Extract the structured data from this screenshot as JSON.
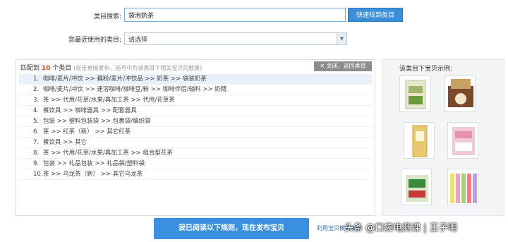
{
  "search": {
    "label": "类目搜索:",
    "value": "袋泡奶茶",
    "button_label": "快速找到类目"
  },
  "recent": {
    "label": "您最近使用的类目:",
    "selected": "请选择"
  },
  "matches": {
    "prefix": "匹配到",
    "count": "10",
    "suffix": "个类目",
    "hint": "(双击直接发布，括号中为该类目下相关宝贝的数量)",
    "close_label": "关闭，返回类目",
    "items": [
      {
        "num": "1.",
        "text": "咖啡/麦片/冲饮 >> 藕粉/麦片/冲饮品 >> 奶茶 >> 袋装奶茶"
      },
      {
        "num": "2.",
        "text": "咖啡/麦片/冲饮 >> 速溶咖啡/咖啡豆/粉 >> 咖啡伴侣/辅料 >> 奶精"
      },
      {
        "num": "3.",
        "text": "茶 >> 代用/花草/水果/再加工茶 >> 代用/花草茶"
      },
      {
        "num": "4.",
        "text": "餐饮具 >> 咖啡器具 >> 配套器具"
      },
      {
        "num": "5.",
        "text": "包装 >> 塑料包装袋 >> 包裹袋/编织袋"
      },
      {
        "num": "6.",
        "text": "茶 >> 红茶（新） >> 其它红茶"
      },
      {
        "num": "7.",
        "text": "餐饮具 >> 其它"
      },
      {
        "num": "8.",
        "text": "茶 >> 代用/花草/水果/再加工茶 >> 组合型花茶"
      },
      {
        "num": "9.",
        "text": "包装 >> 礼品包装 >> 礼品袋/塑料袋"
      },
      {
        "num": "10.",
        "text": "茶 >> 乌龙茶（新） >> 其它乌龙茶"
      }
    ]
  },
  "samples": {
    "title": "该类目下宝贝示例:"
  },
  "footer": {
    "publish_label": "我已阅读以下规则，现在发布宝贝",
    "tool_link": "利用宝贝模板发布",
    "watermark": "头条 @口袋电商课 | 王子明"
  }
}
